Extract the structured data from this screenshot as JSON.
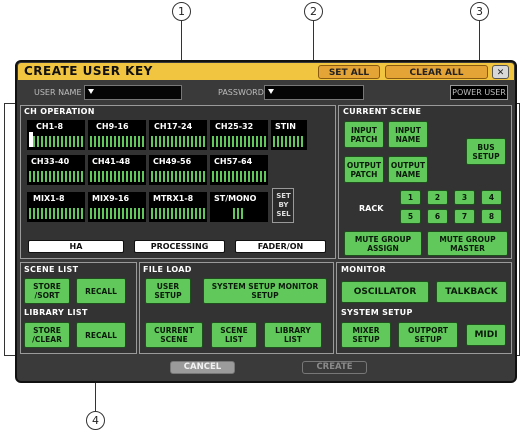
{
  "callouts": [
    "1",
    "2",
    "3",
    "4"
  ],
  "dialog": {
    "title": "CREATE USER KEY",
    "set_all": "SET ALL",
    "clear_all": "CLEAR ALL",
    "close": "✕",
    "user_name_label": "USER NAME",
    "password_label": "PASSWORD",
    "power_user": "POWER USER"
  },
  "ch_operation": {
    "title": "CH OPERATION",
    "rows": [
      [
        "CH1-8",
        "CH9-16",
        "CH17-24",
        "CH25-32",
        "STIN"
      ],
      [
        "CH33-40",
        "CH41-48",
        "CH49-56",
        "CH57-64"
      ],
      [
        "MIX1-8",
        "MIX9-16",
        "MTRX1-8",
        "ST/MONO"
      ]
    ],
    "set_by_sel": "SET BY SEL",
    "buttons": [
      "HA",
      "PROCESSING",
      "FADER/ON"
    ]
  },
  "current_scene": {
    "title": "CURRENT SCENE",
    "input_patch": "INPUT PATCH",
    "input_name": "INPUT NAME",
    "bus_setup": "BUS SETUP",
    "output_patch": "OUTPUT PATCH",
    "output_name": "OUTPUT NAME",
    "rack_label": "RACK",
    "rack": [
      "1",
      "2",
      "3",
      "4",
      "5",
      "6",
      "7",
      "8"
    ],
    "mute_assign": "MUTE GROUP ASSIGN",
    "mute_master": "MUTE GROUP MASTER"
  },
  "scene_list": {
    "title": "SCENE LIST",
    "store_sort": "STORE /SORT",
    "recall": "RECALL"
  },
  "library_list": {
    "title": "LIBRARY LIST",
    "store_clear": "STORE /CLEAR",
    "recall": "RECALL"
  },
  "file_load": {
    "title": "FILE LOAD",
    "user_setup": "USER SETUP",
    "system_setup": "SYSTEM SETUP MONITOR SETUP",
    "current_scene": "CURRENT SCENE",
    "scene_list": "SCENE LIST",
    "library_list": "LIBRARY LIST"
  },
  "monitor": {
    "title": "MONITOR",
    "oscillator": "OSCILLATOR",
    "talkback": "TALKBACK"
  },
  "system_setup": {
    "title": "SYSTEM SETUP",
    "mixer_setup": "MIXER SETUP",
    "outport_setup": "OUTPORT SETUP",
    "midi": "MIDI"
  },
  "footer": {
    "cancel": "CANCEL",
    "create": "CREATE"
  }
}
